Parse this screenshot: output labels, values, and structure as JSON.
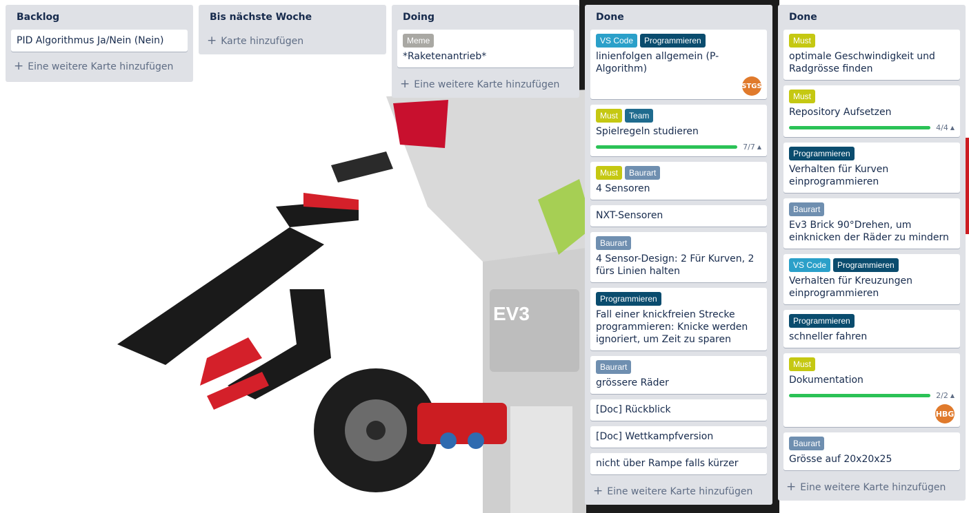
{
  "colors": {
    "list_bg": "#dfe1e6",
    "label_must": "#c5c812",
    "label_team": "#1f6b8e",
    "label_vscode": "#2ba0c9",
    "label_programmieren": "#0a4c6e",
    "label_baurart": "#6f8fb0",
    "label_meme": "#a9a8a3",
    "progress": "#2bc256",
    "avatar": "#e07a2c"
  },
  "lists": [
    {
      "title": "Backlog",
      "cards": [
        {
          "title": "PID Algorithmus Ja/Nein (Nein)"
        }
      ],
      "add_text": "Eine weitere Karte hinzufügen"
    },
    {
      "title": "Bis nächste Woche",
      "cards": [],
      "add_text": "Karte hinzufügen"
    },
    {
      "title": "Doing",
      "cards": [
        {
          "labels": [
            "Meme"
          ],
          "title": "*Raketenantrieb*"
        }
      ],
      "add_text": "Eine weitere Karte hinzufügen"
    },
    {
      "title": "Done",
      "cards": [
        {
          "labels": [
            "VS Code",
            "Programmieren"
          ],
          "title": "linienfolgen allgemein (P-Algorithm)",
          "member": "STGS"
        },
        {
          "labels": [
            "Must",
            "Team"
          ],
          "title": "Spielregeln studieren",
          "checklist": "7/7"
        },
        {
          "labels": [
            "Must",
            "Baurart"
          ],
          "title": "4 Sensoren"
        },
        {
          "title": "NXT-Sensoren"
        },
        {
          "labels": [
            "Baurart"
          ],
          "title": "4 Sensor-Design: 2 Für Kurven, 2 fürs Linien halten"
        },
        {
          "labels": [
            "Programmieren"
          ],
          "title": "Fall einer knickfreien Strecke programmieren: Knicke werden ignoriert, um Zeit zu sparen"
        },
        {
          "labels": [
            "Baurart"
          ],
          "title": "grössere Räder"
        },
        {
          "title": "[Doc] Rückblick"
        },
        {
          "title": "[Doc] Wettkampfversion"
        },
        {
          "title": "nicht über Rampe falls kürzer"
        }
      ],
      "add_text": "Eine weitere Karte hinzufügen"
    },
    {
      "title": "Done",
      "cards": [
        {
          "labels": [
            "Must"
          ],
          "title": "optimale Geschwindigkeit und Radgrösse finden"
        },
        {
          "labels": [
            "Must"
          ],
          "title": "Repository Aufsetzen",
          "checklist": "4/4"
        },
        {
          "labels": [
            "Programmieren"
          ],
          "title": "Verhalten für Kurven einprogrammieren"
        },
        {
          "labels": [
            "Baurart"
          ],
          "title": "Ev3 Brick 90°Drehen, um einknicken der Räder zu mindern"
        },
        {
          "labels": [
            "VS Code",
            "Programmieren"
          ],
          "title": "Verhalten für Kreuzungen einprogrammieren"
        },
        {
          "labels": [
            "Programmieren"
          ],
          "title": "schneller fahren"
        },
        {
          "labels": [
            "Must"
          ],
          "title": "Dokumentation",
          "checklist": "2/2",
          "member": "HBG"
        },
        {
          "labels": [
            "Baurart"
          ],
          "title": "Grösse auf 20x20x25"
        }
      ],
      "add_text": "Eine weitere Karte hinzufügen"
    }
  ],
  "background": {
    "brick_text": "EV3"
  }
}
